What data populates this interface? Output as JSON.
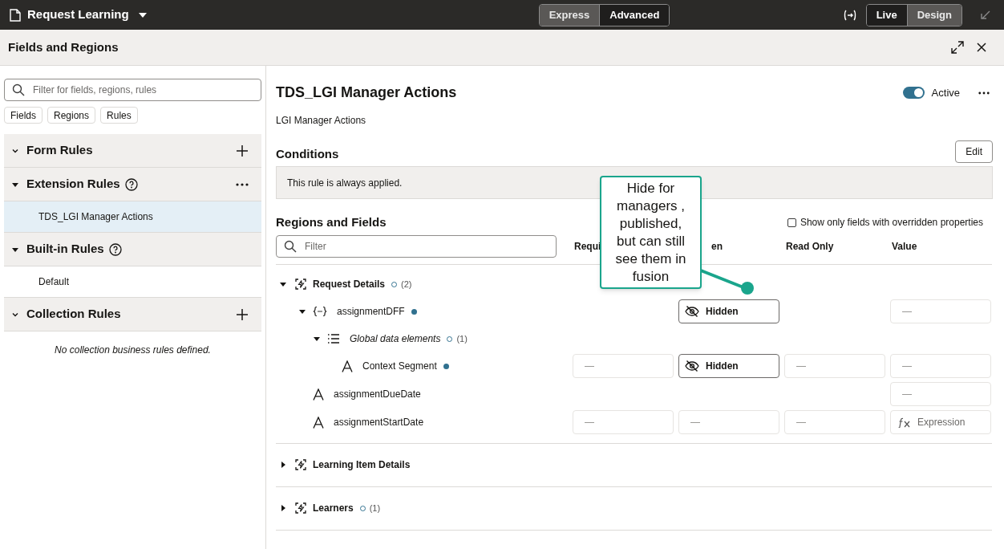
{
  "top_bar": {
    "title": "Request Learning",
    "modes": [
      {
        "label": "Express",
        "selected": true
      },
      {
        "label": "Advanced",
        "selected": false
      }
    ],
    "views": [
      {
        "label": "Live",
        "selected": false
      },
      {
        "label": "Design",
        "selected": true
      }
    ]
  },
  "panel": {
    "title": "Fields and Regions"
  },
  "sidebar": {
    "search": {
      "placeholder": "Filter for fields, regions, rules"
    },
    "filters": [
      "Fields",
      "Regions",
      "Rules"
    ],
    "sections": [
      {
        "title": "Form Rules",
        "kind": "chevron",
        "help": false,
        "add": true,
        "more": false
      },
      {
        "title": "Extension Rules",
        "kind": "caret",
        "help": true,
        "add": false,
        "more": true,
        "items": [
          {
            "label": "TDS_LGI Manager Actions",
            "selected": true
          }
        ]
      },
      {
        "title": "Built-in Rules",
        "kind": "caret",
        "help": true,
        "add": false,
        "more": false,
        "items": [
          {
            "label": "Default",
            "selected": false
          }
        ]
      },
      {
        "title": "Collection Rules",
        "kind": "chevron",
        "help": false,
        "add": true,
        "more": false,
        "empty_message": "No collection business rules defined."
      }
    ]
  },
  "rule": {
    "title": "TDS_LGI Manager Actions",
    "subtitle": "LGI Manager Actions",
    "active": {
      "label": "Active",
      "on": true
    },
    "conditions": {
      "title": "Conditions",
      "edit": "Edit",
      "text": "This rule is always applied."
    },
    "regions_and_fields": {
      "title": "Regions and Fields",
      "only_overridden": {
        "label": "Show only fields with overridden properties",
        "checked": false
      },
      "filter": {
        "placeholder": "Filter"
      },
      "columns": [
        "Requi",
        "en",
        "Read Only",
        "Value"
      ],
      "regions": [
        {
          "name": "Request Details",
          "expanded": true,
          "overridden": false,
          "count": "(2)",
          "fields": [
            {
              "name": "assignmentDFF",
              "kind": "dff",
              "expanded": true,
              "overridden": true,
              "cells": {
                "hidden": {
                  "kind": "hidden",
                  "text": "Hidden"
                },
                "value": {
                  "kind": "dash",
                  "text": "—"
                }
              },
              "children": [
                {
                  "name": "Global data elements",
                  "kind": "group",
                  "expanded": true,
                  "overridden": false,
                  "count": "(1)",
                  "children": [
                    {
                      "name": "Context Segment",
                      "kind": "text",
                      "overridden": true,
                      "cells": {
                        "required": {
                          "kind": "dash",
                          "text": "—"
                        },
                        "hidden": {
                          "kind": "hidden",
                          "text": "Hidden"
                        },
                        "read_only": {
                          "kind": "dash",
                          "text": "—"
                        },
                        "value": {
                          "kind": "dash",
                          "text": "—"
                        }
                      }
                    }
                  ]
                }
              ]
            },
            {
              "name": "assignmentDueDate",
              "kind": "text",
              "cells": {
                "value": {
                  "kind": "dash",
                  "text": "—"
                }
              }
            },
            {
              "name": "assignmentStartDate",
              "kind": "text",
              "cells": {
                "required": {
                  "kind": "dash",
                  "text": "—"
                },
                "hidden": {
                  "kind": "dash",
                  "text": "—"
                },
                "read_only": {
                  "kind": "dash",
                  "text": "—"
                },
                "value": {
                  "kind": "expression",
                  "text": "Expression"
                }
              }
            }
          ]
        },
        {
          "name": "Learning Item Details",
          "expanded": false
        },
        {
          "name": "Learners",
          "expanded": false,
          "overridden": false,
          "count": "(1)"
        }
      ]
    }
  },
  "callout": {
    "text": "Hide for managers , published, but can still see them in fusion"
  }
}
